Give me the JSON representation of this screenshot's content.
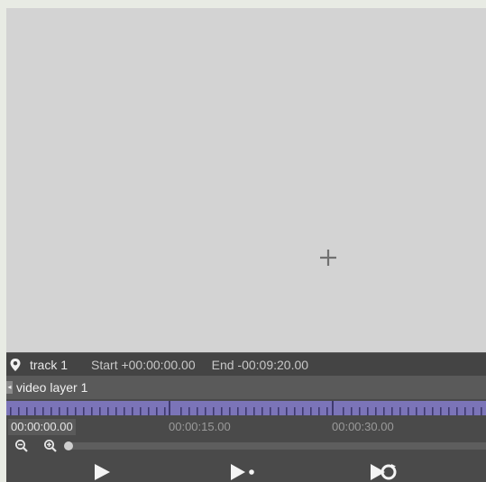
{
  "viewer": {
    "crosshair_icon": "crosshair-icon"
  },
  "track": {
    "icon": "location-pin-icon",
    "name": "track 1",
    "start": "Start +00:00:00.00",
    "end": "End -00:09:20.00"
  },
  "layer": {
    "handle_icon": "collapse-handle-icon",
    "name": "video layer 1"
  },
  "timeline": {
    "current_time": "00:00:00.00",
    "markers": [
      "00:00:15.00",
      "00:00:30.00"
    ]
  },
  "zoom": {
    "zoom_out_icon": "zoom-out-icon",
    "zoom_in_icon": "zoom-in-icon",
    "level": 0
  },
  "transport": {
    "play_icon": "play-icon",
    "play_step_icon": "play-step-icon",
    "loop_icon": "loop-play-icon"
  },
  "colors": {
    "canvas": "#d3d3d3",
    "panel": "#4a4a4a",
    "ruler": "#7b74b8"
  }
}
